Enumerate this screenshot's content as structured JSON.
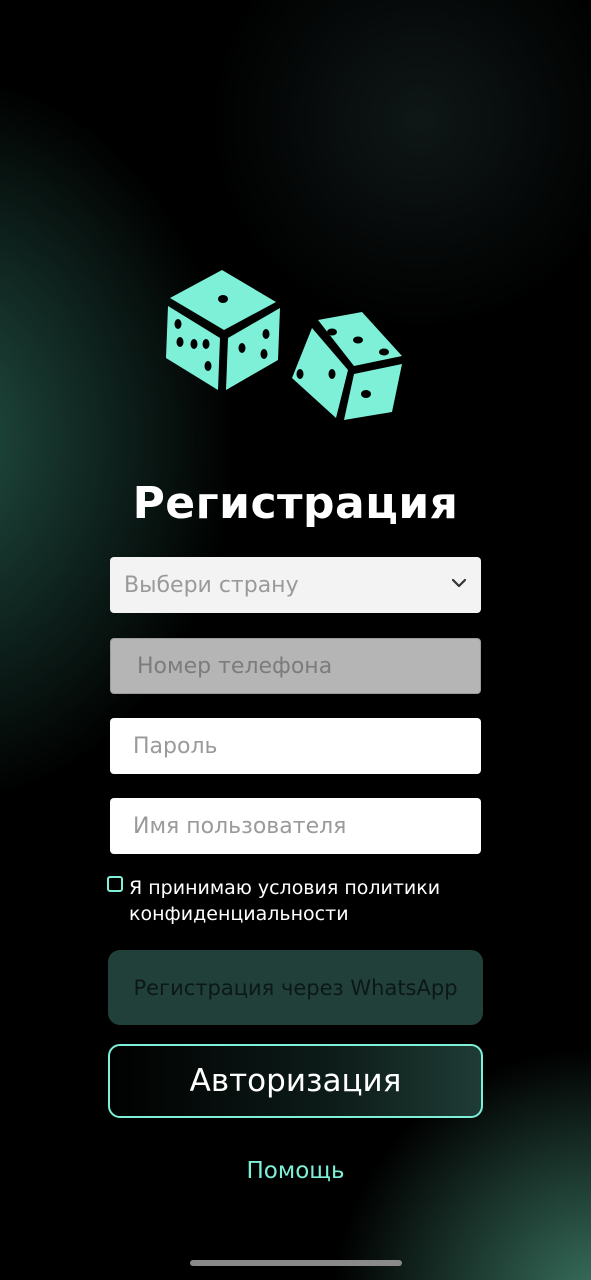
{
  "app": {
    "title": "Регистрация",
    "logo_icon": "dice-icon",
    "accent_color": "#7ff0d8"
  },
  "form": {
    "country_select": {
      "placeholder": "Выбери страну",
      "icon": "chevron-down-icon"
    },
    "phone_field": {
      "placeholder": "Номер телефона"
    },
    "password_field": {
      "placeholder": "Пароль"
    },
    "username_field": {
      "placeholder": "Имя пользователя"
    },
    "consent": {
      "label": "Я принимаю условия политики конфиденциальности",
      "checked": false
    }
  },
  "actions": {
    "whatsapp_label": "Регистрация через WhatsApp",
    "login_label": "Авторизация",
    "help_label": "Помощь"
  }
}
